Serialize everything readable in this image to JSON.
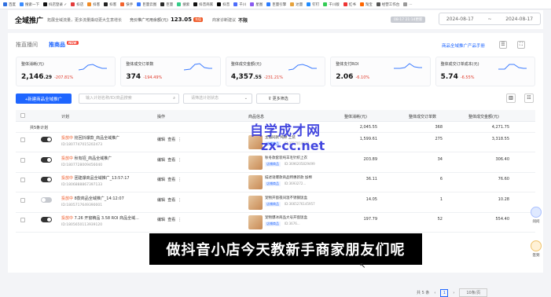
{
  "bookmarks": [
    {
      "label": "百度",
      "color": "#2f6fe0"
    },
    {
      "label": "搜索一下",
      "color": "#3b8cff"
    },
    {
      "label": "抖店登录 ✓",
      "color": "#111"
    },
    {
      "label": "抖店",
      "color": "#e23b3b"
    },
    {
      "label": "抖客",
      "color": "#f08a24"
    },
    {
      "label": "抖客",
      "color": "#222"
    },
    {
      "label": "快手",
      "color": "#f2622d"
    },
    {
      "label": "巨量云图",
      "color": "#3778ff"
    },
    {
      "label": "巨量",
      "color": "#2a2a2a"
    },
    {
      "label": "搜索",
      "color": "#3c8"
    },
    {
      "label": "抖音商家",
      "color": "#111"
    },
    {
      "label": "抖音",
      "color": "#000"
    },
    {
      "label": "千川",
      "color": "#4b6bfb"
    },
    {
      "label": "星图",
      "color": "#8a5bf0"
    },
    {
      "label": "巨量引擎",
      "color": "#2b7bff"
    },
    {
      "label": "达量",
      "color": "#e6a23c"
    },
    {
      "label": "钉钉",
      "color": "#1f8bff"
    },
    {
      "label": "千川版",
      "color": "#3c5"
    },
    {
      "label": "红书",
      "color": "#e33"
    },
    {
      "label": "淘宝",
      "color": "#f60"
    },
    {
      "label": "经营工作台",
      "color": "#555"
    },
    {
      "label": "...",
      "color": "#999"
    }
  ],
  "header": {
    "brand": "全域推广",
    "subtitle": "拓展全域流量，更多流量撬动更大生意增长",
    "k1": "竞价推广可用余额(元)",
    "v1": "123.05",
    "tag": "充值",
    "k2": "商家诊断建议",
    "v2": "不限",
    "updated": "08-17 21:14更新",
    "date_from": "2024-08-17",
    "date_sep": "~",
    "date_to": "2024-08-17"
  },
  "tabs": {
    "t1": "推直播间",
    "t2": "推商品",
    "new": "NEW"
  },
  "manual": "商品全域推广产品手册",
  "metrics": [
    {
      "label": "整体消耗(元)",
      "value": "2,146",
      "decimal": ".29",
      "change": "-207.81%"
    },
    {
      "label": "整体成交订单数",
      "value": "374",
      "decimal": "",
      "change": "-194.49%"
    },
    {
      "label": "整体成交金额(元)",
      "value": "4,357",
      "decimal": ".55",
      "change": "-231.21%"
    },
    {
      "label": "整体支付ROI",
      "value": "2.06",
      "decimal": "",
      "change": "-6.10%"
    },
    {
      "label": "整体成交订单成本(元)",
      "value": "5.74",
      "decimal": "",
      "change": "-6.55%"
    }
  ],
  "toolbar": {
    "new": "+新建商品全域推广",
    "search_ph": "输入计划名称/ID/商品搜索",
    "status_ph": "请筛选计划状态",
    "filter": "更多筛选"
  },
  "table": {
    "h_plan": "计划",
    "h_ops": "操作",
    "h_prod": "商品信息",
    "h_spend": "整体消耗(元)",
    "h_orders": "整体成交订单数",
    "h_gmv": "整体成交金额(元)"
  },
  "summary": {
    "label": "共5条计划",
    "spend": "2,045.55",
    "orders": "368",
    "gmv": "4,271.75"
  },
  "rows": [
    {
      "status": "投放中",
      "name": "抢回抖爆款_商品全域推广",
      "id": "ID:1807747015202473",
      "edit": "编辑",
      "view": "查看",
      "prod": "主播同款 纯棉 上装",
      "badge": "店铺商品",
      "pid": "ID:3717014620",
      "spend": "1,599.61",
      "orders": "275",
      "gmv": "3,318.55"
    },
    {
      "status": "投放中",
      "name": "秋有招_商品全域推广",
      "id": "ID:1807728009456040",
      "edit": "编辑",
      "view": "查看",
      "prod": "秋冬款套装纯羊毛针织上衣",
      "badge": "店铺商品",
      "pid": "ID:3696205829499",
      "spend": "203.89",
      "orders": "34",
      "gmv": "306.40"
    },
    {
      "status": "投放中",
      "name": "团建爆商品全域推广_13:57:17",
      "id": "ID:1806888867397133",
      "edit": "编辑",
      "view": "查看",
      "prod": "描述语爆款商品特惠新款 加棉",
      "badge": "店铺商品",
      "pid": "ID:3693272...",
      "spend": "36.11",
      "orders": "6",
      "gmv": "76.60"
    },
    {
      "status": "投放中",
      "name": "8款商品全域推广_14:12:07",
      "id": "ID:1805717649390001",
      "edit": "编辑",
      "view": "查看",
      "prod": "宠物开窗夜间温不锈钢饭盒",
      "badge": "店铺商品",
      "pid": "ID:3665276145957",
      "spend": "14.05",
      "orders": "1",
      "gmv": "10.28"
    },
    {
      "status": "投放中",
      "name": "7.26 开窗精品 3.58 ROI 商品全域...",
      "id": "ID:1805650113939120",
      "edit": "编辑",
      "view": "查看",
      "prod": "宠物爆冰商品大号开窗饭盒",
      "badge": "店铺商品",
      "pid": "ID:3676...",
      "spend": "197.79",
      "orders": "52",
      "gmv": "554.40"
    }
  ],
  "pager": {
    "total": "共 5 条",
    "page": "1",
    "size": "10条/页"
  },
  "float": {
    "q": "问问",
    "sign": "签到"
  },
  "watermark": {
    "line1": "自学成才网",
    "line2": "zx-cc.net"
  },
  "caption": "做抖音小店今天教新手商家朋友们呢",
  "colors": {
    "accent": "#1f66ff",
    "negative": "#e03b2c"
  }
}
